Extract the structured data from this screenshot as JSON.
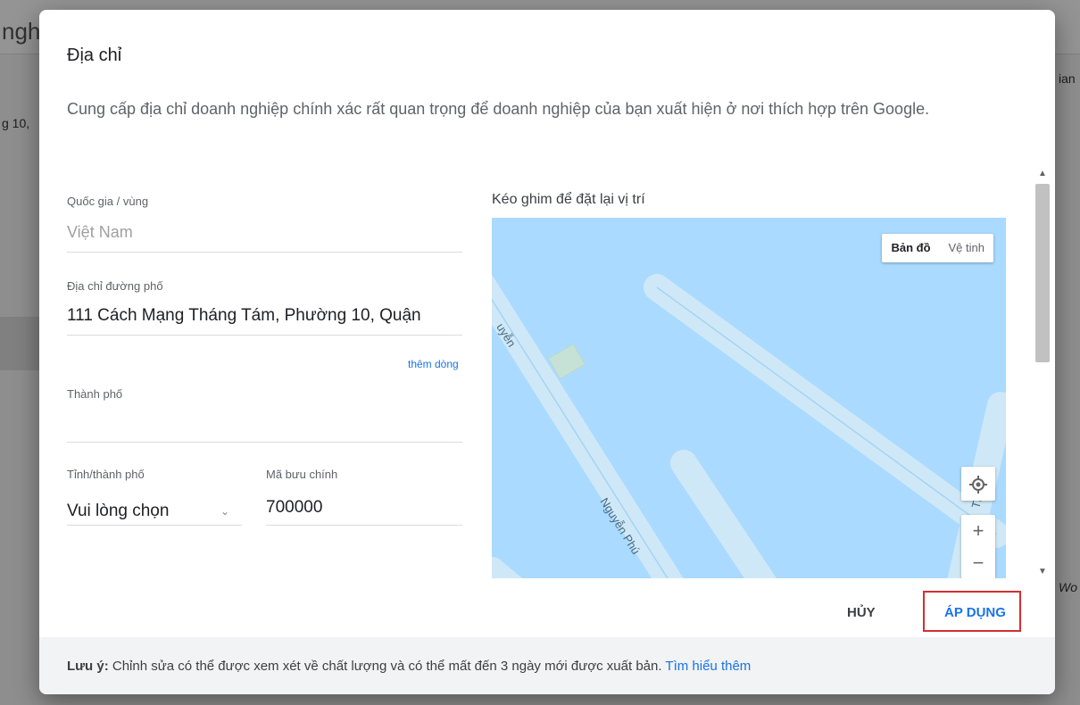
{
  "background": {
    "fragments": [
      "ngh",
      "g 10,",
      "ian",
      "Wo"
    ]
  },
  "dialog": {
    "title": "Địa chỉ",
    "description": "Cung cấp địa chỉ doanh nghiệp chính xác rất quan trọng để doanh nghiệp của bạn xuất hiện ở nơi thích hợp trên Google."
  },
  "form": {
    "country": {
      "label": "Quốc gia / vùng",
      "value": "Việt Nam"
    },
    "street": {
      "label": "Địa chỉ đường phố",
      "value": "111 Cách Mạng Tháng Tám, Phường 10, Quận"
    },
    "add_line": "thêm dòng",
    "city": {
      "label": "Thành phố",
      "value": ""
    },
    "province": {
      "label": "Tỉnh/thành phố",
      "value": "Vui lòng chọn"
    },
    "postal": {
      "label": "Mã bưu chính",
      "value": "700000"
    }
  },
  "map": {
    "caption": "Kéo ghim để đặt lại vị trí",
    "toggle_map": "Bản đồ",
    "toggle_satellite": "Vệ tinh",
    "zoom_in": "+",
    "zoom_out": "−",
    "road_labels": [
      "uyễn",
      "Nguyễn Phú",
      "Tháng"
    ],
    "water_color": "#aadaff"
  },
  "actions": {
    "cancel": "HỦY",
    "apply": "ÁP DỤNG",
    "highlight_color": "#d32f2f"
  },
  "footer": {
    "note_label": "Lưu ý:",
    "note_text": " Chỉnh sửa có thể được xem xét về chất lượng và có thể mất đến 3 ngày mới được xuất bản. ",
    "learn_more": "Tìm hiểu thêm"
  }
}
